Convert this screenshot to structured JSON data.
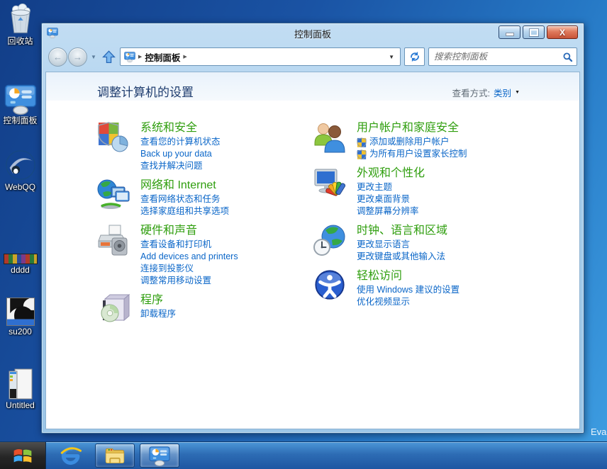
{
  "window": {
    "title": "控制面板",
    "breadcrumb_root": "控制面板",
    "search_placeholder": "搜索控制面板",
    "header": {
      "title": "调整计算机的设置",
      "view_by_label": "查看方式:",
      "view_by_value": "类别"
    }
  },
  "categories": {
    "left": [
      {
        "title": "系统和安全",
        "links": [
          "查看您的计算机状态",
          "Back up your data",
          "查找并解决问题"
        ]
      },
      {
        "title": "网络和 Internet",
        "links": [
          "查看网络状态和任务",
          "选择家庭组和共享选项"
        ]
      },
      {
        "title": "硬件和声音",
        "links": [
          "查看设备和打印机",
          "Add devices and printers",
          "连接到投影仪",
          "调整常用移动设置"
        ]
      },
      {
        "title": "程序",
        "links": [
          "卸载程序"
        ]
      }
    ],
    "right": [
      {
        "title": "用户帐户和家庭安全",
        "links": [
          "添加或删除用户帐户",
          "为所有用户设置家长控制"
        ]
      },
      {
        "title": "外观和个性化",
        "links": [
          "更改主题",
          "更改桌面背景",
          "调整屏幕分辨率"
        ]
      },
      {
        "title": "时钟、语言和区域",
        "links": [
          "更改显示语言",
          "更改键盘或其他输入法"
        ]
      },
      {
        "title": "轻松访问",
        "links": [
          "使用 Windows 建议的设置",
          "优化视频显示"
        ]
      }
    ]
  },
  "desktop": {
    "icons": [
      {
        "label": "回收站"
      },
      {
        "label": "控制面板"
      },
      {
        "label": "WebQQ"
      },
      {
        "label": "dddd"
      },
      {
        "label": "su200"
      },
      {
        "label": "Untitled"
      }
    ],
    "watermark": "Eva"
  },
  "colors": {
    "category_green": "#2f9e0e",
    "link_blue": "#0a66c8",
    "heading_navy": "#1e3c6e",
    "titlebar_blue": "#a9d0ed",
    "taskbar_blue": "#2d6cb4",
    "close_red": "#c85438"
  }
}
